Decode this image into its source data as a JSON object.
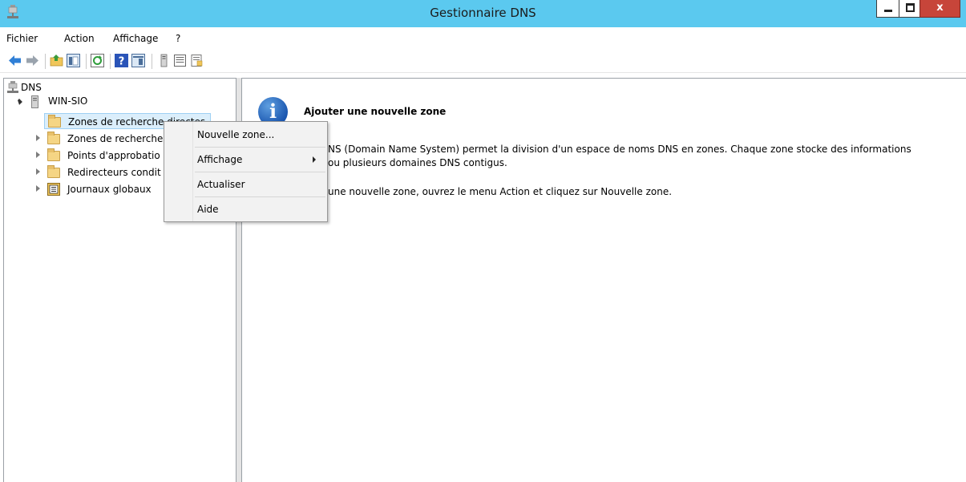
{
  "window": {
    "title": "Gestionnaire DNS",
    "close_glyph": "x"
  },
  "menubar": {
    "items": [
      "Fichier",
      "Action",
      "Affichage",
      "?"
    ]
  },
  "toolbar": {
    "icons": [
      "back-arrow-icon",
      "forward-arrow-icon",
      "up-folder-icon",
      "show-hide-tree-icon",
      "refresh-icon",
      "help-icon",
      "show-hide-action-pane-icon",
      "server-icon",
      "list-icon",
      "properties-icon"
    ]
  },
  "tree": {
    "root": "DNS",
    "server": "WIN-SIO",
    "items": [
      {
        "label": "Zones de recherche directes"
      },
      {
        "label": "Zones de recherche"
      },
      {
        "label": "Points d'approbatio"
      },
      {
        "label": "Redirecteurs condit"
      },
      {
        "label": "Journaux globaux"
      }
    ]
  },
  "content": {
    "heading": "Ajouter une nouvelle zone",
    "line1": "NS (Domain Name System) permet la division d'un espace de noms DNS en zones. Chaque zone stocke des informations",
    "line2": "ou plusieurs domaines DNS contigus.",
    "line3": "une nouvelle zone, ouvrez le menu Action et cliquez sur Nouvelle zone."
  },
  "context_menu": {
    "items": [
      {
        "label": "Nouvelle zone..."
      },
      {
        "label": "Affichage",
        "has_submenu": true
      },
      {
        "label": "Actualiser"
      },
      {
        "label": "Aide"
      }
    ]
  },
  "colors": {
    "titlebar": "#5bc9ef",
    "close_button": "#c7453a",
    "selection": "#dbeefb"
  }
}
